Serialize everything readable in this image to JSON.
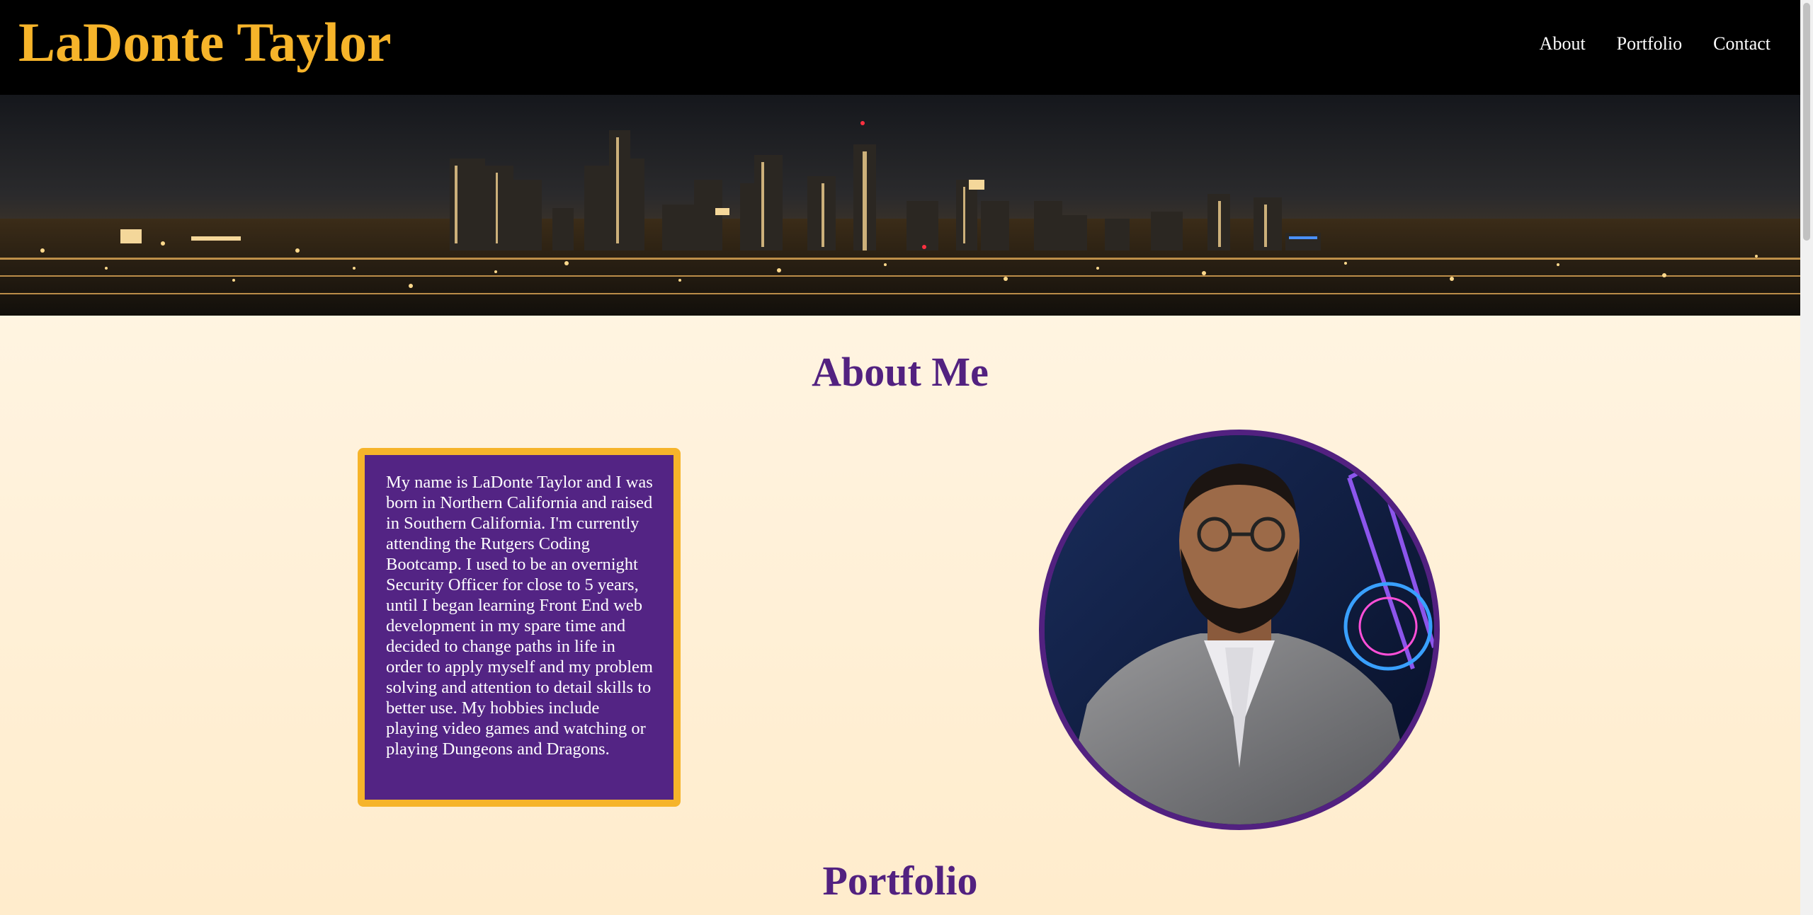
{
  "header": {
    "site_title": "LaDonte Taylor",
    "nav": [
      "About",
      "Portfolio",
      "Contact"
    ]
  },
  "hero": {
    "image": "city-skyline-night-photo"
  },
  "about": {
    "heading": "About Me",
    "bio": "My name is LaDonte Taylor and I was born in Northern California and raised in Southern California. I'm currently attending the Rutgers Coding Bootcamp. I used to be an overnight Security Officer for close to 5 years, until I began learning Front End web development in my spare time and decided to change paths in life in order to apply myself and my problem solving and attention to detail skills to better use. My hobbies include playing video games and watching or playing Dungeons and Dragons.",
    "portrait": "profile-photo"
  },
  "portfolio": {
    "heading": "Portfolio"
  },
  "colors": {
    "accent_gold": "#f6b42a",
    "accent_purple": "#522180",
    "header_bg": "#000000"
  }
}
